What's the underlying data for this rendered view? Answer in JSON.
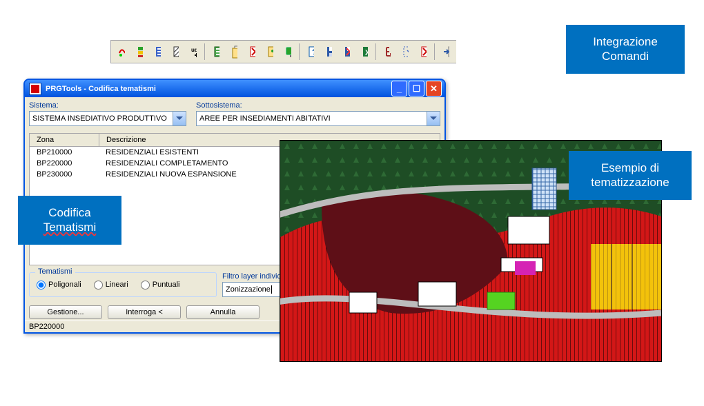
{
  "toolbar": {
    "icons": [
      "squiggle-icon",
      "layers-green-icon",
      "layers-blue-icon",
      "hatch-icon",
      "udm-icon",
      "list-green-icon",
      "doc-stack-icon",
      "doc-x-red-icon",
      "doc-tools-icon",
      "monitor-icon",
      "help-icon",
      "save-icon",
      "save-x-icon",
      "excel-icon",
      "scale-icon",
      "selector-icon",
      "no-cross-icon",
      "import-icon"
    ]
  },
  "dialog": {
    "title": "PRGTools - Codifica tematismi",
    "labels": {
      "sistema": "Sistema:",
      "sottosistema": "Sottosistema:",
      "zona": "Zona",
      "descrizione": "Descrizione",
      "tematismi_group": "Tematismi",
      "poligonali": "Poligonali",
      "lineari": "Lineari",
      "puntuali": "Puntuali",
      "filtro": "Filtro layer individuazione",
      "gestione": "Gestione...",
      "interroga": "Interroga <",
      "annulla": "Annulla"
    },
    "sistema_value": "SISTEMA INSEDIATIVO PRODUTTIVO",
    "sottosistema_value": "AREE PER INSEDIAMENTI ABITATIVI",
    "zones": [
      {
        "code": "BP210000",
        "desc": "RESIDENZIALI ESISTENTI"
      },
      {
        "code": "BP220000",
        "desc": "RESIDENZIALI COMPLETAMENTO"
      },
      {
        "code": "BP230000",
        "desc": "RESIDENZIALI NUOVA ESPANSIONE"
      }
    ],
    "filtro_value": "Zonizzazione",
    "status": "BP220000",
    "tematismi_selected": "Poligonali"
  },
  "callouts": {
    "integrazione_l1": "Integrazione",
    "integrazione_l2": "Comandi",
    "codifica_l1": "Codifica",
    "codifica_l2": "Tematismi",
    "esempio_l1": "Esempio di",
    "esempio_l2": "tematizzazione"
  }
}
